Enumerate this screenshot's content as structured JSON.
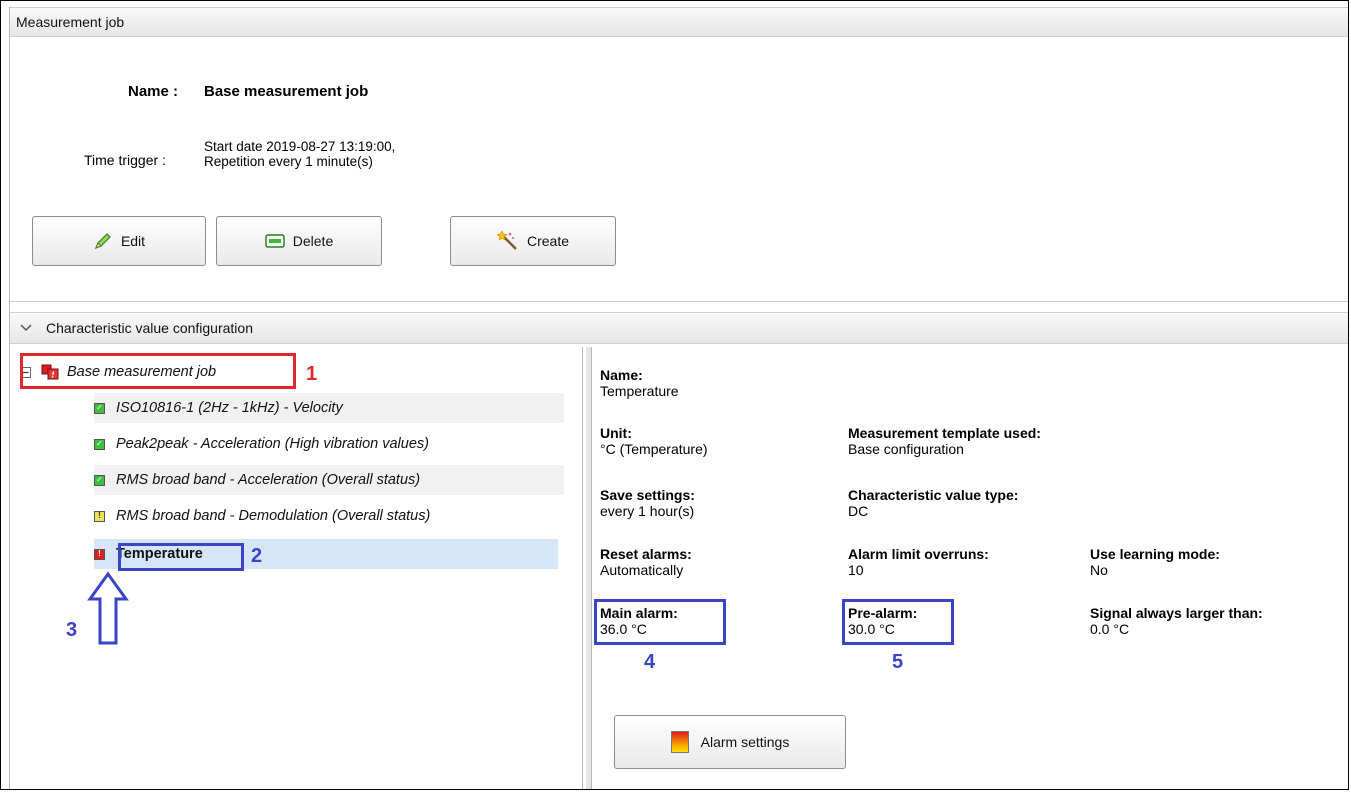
{
  "header": {
    "title": "Measurement job"
  },
  "job": {
    "name_label": "Name :",
    "name_value": "Base measurement job",
    "trigger_label": "Time trigger :",
    "trigger_line1": "Start date 2019-08-27 13:19:00,",
    "trigger_line2": "Repetition every 1 minute(s)"
  },
  "toolbar": {
    "edit_label": "Edit",
    "delete_label": "Delete",
    "create_label": "Create"
  },
  "config": {
    "title": "Characteristic value configuration"
  },
  "tree": {
    "root": "Base measurement job",
    "items": [
      {
        "label": "ISO10816-1 (2Hz - 1kHz) - Velocity",
        "status": "ok"
      },
      {
        "label": "Peak2peak - Acceleration (High vibration values)",
        "status": "ok"
      },
      {
        "label": "RMS broad band - Acceleration (Overall status)",
        "status": "ok"
      },
      {
        "label": "RMS broad band - Demodulation (Overall status)",
        "status": "warning"
      },
      {
        "label": "Temperature",
        "status": "alarm"
      }
    ]
  },
  "details": {
    "name_label": "Name:",
    "name_value": "Temperature",
    "unit_label": "Unit:",
    "unit_value": "°C (Temperature)",
    "template_label": "Measurement template used:",
    "template_value": "Base configuration",
    "save_label": "Save settings:",
    "save_value": "every 1 hour(s)",
    "type_label": "Characteristic value type:",
    "type_value": "DC",
    "reset_label": "Reset alarms:",
    "reset_value": "Automatically",
    "overruns_label": "Alarm limit overruns:",
    "overruns_value": "10",
    "learning_label": "Use learning mode:",
    "learning_value": "No",
    "main_alarm_label": "Main alarm:",
    "main_alarm_value": "36.0 °C",
    "pre_alarm_label": "Pre-alarm:",
    "pre_alarm_value": "30.0 °C",
    "signal_label": "Signal always larger than:",
    "signal_value": "0.0 °C",
    "alarm_settings_label": "Alarm settings"
  },
  "annotations": {
    "n1": "1",
    "n2": "2",
    "n3": "3",
    "n4": "4",
    "n5": "5"
  },
  "colors": {
    "annotation_red": "#e3262d",
    "annotation_blue": "#3b43c7",
    "selected_row": "#d6e6f7"
  }
}
